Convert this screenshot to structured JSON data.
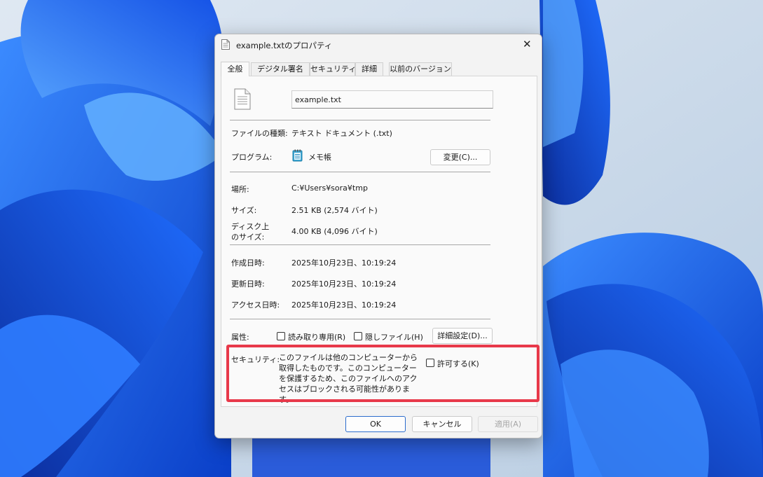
{
  "colors": {
    "highlight": "#e8394a",
    "primary_border": "#2b6ccc"
  },
  "dialog": {
    "title": "example.txtのプロパティ",
    "title_icon": "text-file-icon",
    "close_icon": "close-icon",
    "tabs": [
      {
        "label": "全般",
        "active": true
      },
      {
        "label": "デジタル署名",
        "active": false
      },
      {
        "label": "セキュリティ",
        "active": false
      },
      {
        "label": "詳細",
        "active": false
      },
      {
        "label": "以前のバージョン",
        "active": false
      }
    ]
  },
  "general": {
    "file_name": "example.txt",
    "file_type_label": "ファイルの種類:",
    "file_type_value": "テキスト ドキュメント (.txt)",
    "program_label": "プログラム:",
    "program_value": "メモ帳",
    "change_button": "変更(C)...",
    "location_label": "場所:",
    "location_value": "C:¥Users¥sora¥tmp",
    "size_label": "サイズ:",
    "size_value": "2.51 KB (2,574 バイト)",
    "disk_size_label_1": "ディスク上",
    "disk_size_label_2": "のサイズ:",
    "disk_size_value": "4.00 KB (4,096 バイト)",
    "created_label": "作成日時:",
    "created_value": "2025年10月23日、10:19:24",
    "modified_label": "更新日時:",
    "modified_value": "2025年10月23日、10:19:24",
    "accessed_label": "アクセス日時:",
    "accessed_value": "2025年10月23日、10:19:24",
    "attributes_label": "属性:",
    "readonly_label": "読み取り専用(R)",
    "hidden_label": "隠しファイル(H)",
    "advanced_button": "詳細設定(D)...",
    "security_label": "セキュリティ:",
    "security_text": "このファイルは他のコンピューターから取得したものです。このコンピューターを保護するため、このファイルへのアクセスはブロックされる可能性があります。",
    "unblock_label": "許可する(K)"
  },
  "footer": {
    "ok": "OK",
    "cancel": "キャンセル",
    "apply": "適用(A)"
  }
}
